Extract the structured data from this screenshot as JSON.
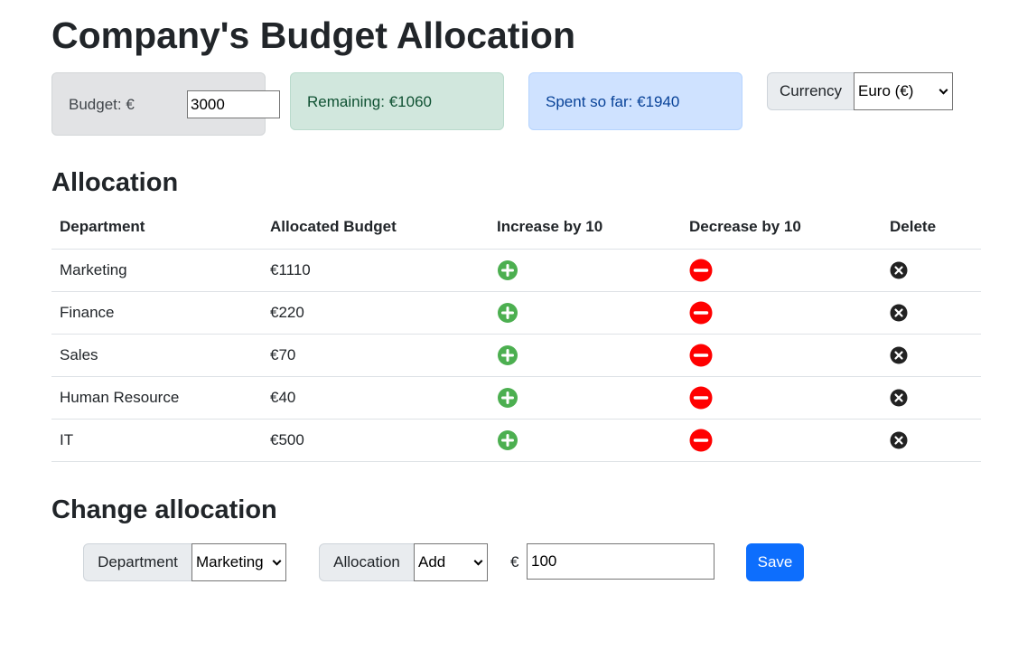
{
  "header": {
    "title": "Company's Budget Allocation"
  },
  "summary": {
    "budget_label": "Budget: €",
    "budget_value": "3000",
    "remaining": "Remaining: €1060",
    "spent": "Spent so far: €1940",
    "currency_label": "Currency",
    "currency_selected": "Euro (€)"
  },
  "allocation": {
    "heading": "Allocation",
    "columns": [
      "Department",
      "Allocated Budget",
      "Increase by 10",
      "Decrease by 10",
      "Delete"
    ],
    "rows": [
      {
        "department": "Marketing",
        "budget": "€1110"
      },
      {
        "department": "Finance",
        "budget": "€220"
      },
      {
        "department": "Sales",
        "budget": "€70"
      },
      {
        "department": "Human Resource",
        "budget": "€40"
      },
      {
        "department": "IT",
        "budget": "€500"
      }
    ]
  },
  "change": {
    "heading": "Change allocation",
    "department_label": "Department",
    "department_selected": "Marketing",
    "allocation_label": "Allocation",
    "allocation_selected": "Add",
    "currency_symbol": "€",
    "amount_value": "100",
    "save_label": "Save"
  },
  "icons": {
    "increase": "plus-circle-icon",
    "decrease": "minus-circle-icon",
    "delete": "x-circle-icon"
  },
  "colors": {
    "increase": "#4caf50",
    "decrease": "#ff0000",
    "delete": "#222222",
    "primary": "#0d6efd"
  }
}
